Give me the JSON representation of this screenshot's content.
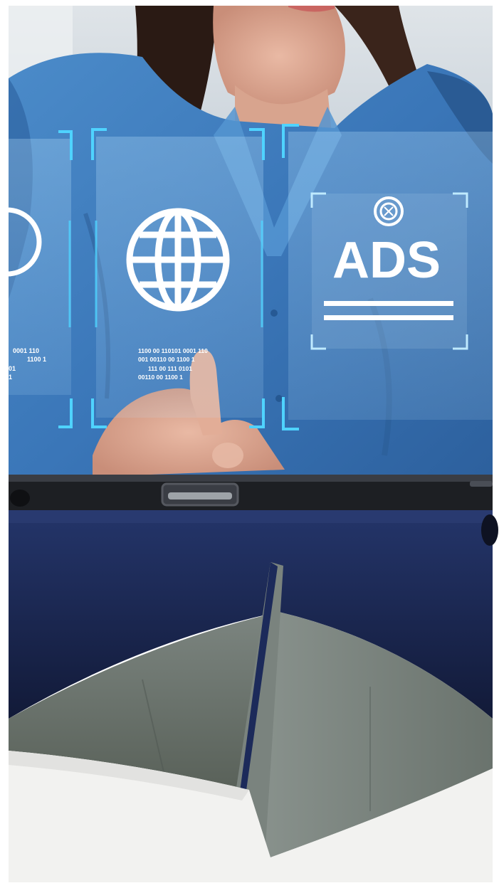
{
  "scene": {
    "description_colors": {
      "shirt": "#3f7fbf",
      "hologram_accent": "#4fd3ff",
      "tablet_case": "#1c2a52",
      "case_fold": "#6b756f",
      "table": "#f4f4f2"
    },
    "holograms": {
      "left_panel": {
        "icon": "circle-icon",
        "code_lines": [
          "0001 110",
          "1100 1",
          "01",
          "1"
        ]
      },
      "center_panel": {
        "icon": "globe-icon",
        "code_lines": [
          "1100 00 110101  0001 110",
          "001   00110 00  1100 1",
          "111 00 111 0101",
          "00110 00  1100 1"
        ]
      },
      "right_panel": {
        "icon": "target-icon",
        "label": "ADS"
      }
    }
  }
}
